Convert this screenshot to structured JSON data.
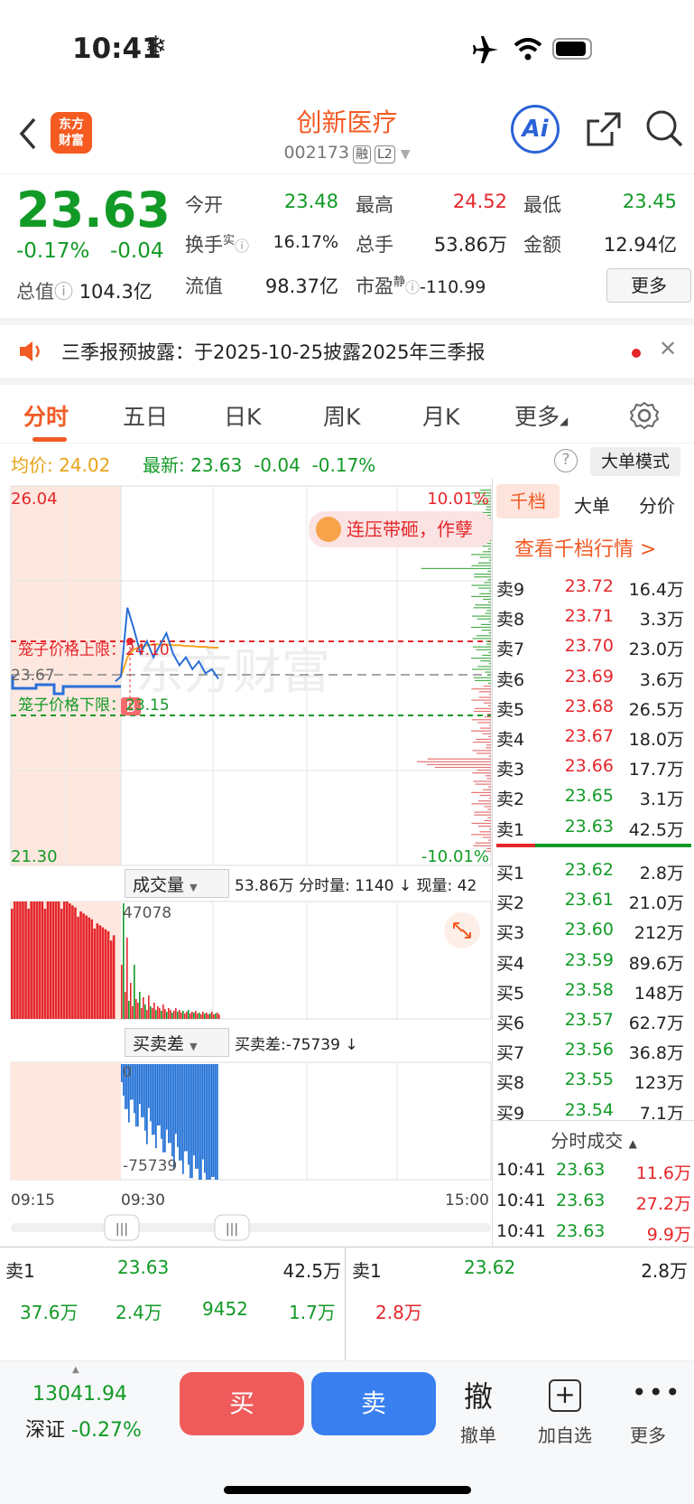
{
  "status": {
    "time": "10:41"
  },
  "header": {
    "logo": "东方\n财富",
    "title": "创新医疗",
    "code": "002173",
    "tag1": "融",
    "tag2": "L2",
    "ai_label": "Ai"
  },
  "quote": {
    "price": "23.63",
    "change_pct": "-0.17%",
    "change": "-0.04",
    "open_label": "今开",
    "open": "23.48",
    "high_label": "最高",
    "high": "24.52",
    "low_label": "最低",
    "low": "23.45",
    "turnover_label": "换手",
    "turnover_sup": "实",
    "turnover": "16.17%",
    "vol_label": "总手",
    "vol": "53.86万",
    "amount_label": "金额",
    "amount": "12.94亿",
    "mcap_label": "总值",
    "mcap": "104.3亿",
    "float_label": "流值",
    "float": "98.37亿",
    "pe_label": "市盈",
    "pe_sup": "静",
    "pe": "-110.99",
    "more": "更多"
  },
  "notice": {
    "text": "三季报预披露：于2025-10-25披露2025年三季报"
  },
  "tabs": [
    "分时",
    "五日",
    "日K",
    "周K",
    "月K",
    "更多"
  ],
  "chart": {
    "avg_label": "均价:",
    "avg": "24.02",
    "last_label": "最新:",
    "last": "23.63",
    "chg": "-0.04",
    "chg_pct": "-0.17%",
    "mode_btn": "大单模式",
    "y_top": "26.04",
    "y_bottom": "21.30",
    "pct_top": "10.01%",
    "pct_bottom": "-10.01%",
    "prev_close": "23.67",
    "cage_upper": "笼子价格上限：24.10",
    "cage_lower": "笼子价格下限：23.15",
    "buy_marker": "B",
    "bubble": "连压带砸，作孽",
    "vol_select": "成交量",
    "vol_info": "53.86万 分时量: 1140 ↓ 现量: 42",
    "vol_peak": "47078",
    "diff_select": "买卖差",
    "diff_info": "买卖差:-75739 ↓",
    "diff_min": "-75739",
    "diff_zero": "0",
    "t_start": "09:15",
    "t_open": "09:30",
    "t_end": "15:00"
  },
  "chart_data": {
    "type": "line",
    "title": "",
    "x": [
      "09:15",
      "09:30",
      "09:35",
      "09:40",
      "09:45",
      "09:50",
      "09:55",
      "10:00",
      "10:05",
      "10:10",
      "10:15",
      "10:20",
      "10:25",
      "10:30",
      "10:35",
      "10:40",
      "10:41"
    ],
    "series": [
      {
        "name": "最新",
        "values": [
          23.6,
          23.66,
          24.52,
          24.25,
          23.95,
          24.1,
          23.9,
          24.05,
          24.2,
          23.95,
          23.8,
          23.9,
          23.75,
          23.85,
          23.7,
          23.75,
          23.63
        ]
      },
      {
        "name": "均价",
        "values": [
          null,
          23.66,
          23.9,
          24.0,
          24.03,
          24.05,
          24.06,
          24.06,
          24.06,
          24.05,
          24.05,
          24.04,
          24.04,
          24.03,
          24.03,
          24.02,
          24.02
        ]
      }
    ],
    "ylim": [
      21.3,
      26.04
    ]
  },
  "orderbook": {
    "tabs": [
      "千档",
      "大单",
      "分价"
    ],
    "link": "查看千档行情 >",
    "asks": [
      {
        "l": "卖9",
        "p": "23.72",
        "v": "16.4万"
      },
      {
        "l": "卖8",
        "p": "23.71",
        "v": "3.3万"
      },
      {
        "l": "卖7",
        "p": "23.70",
        "v": "23.0万"
      },
      {
        "l": "卖6",
        "p": "23.69",
        "v": "3.6万"
      },
      {
        "l": "卖5",
        "p": "23.68",
        "v": "26.5万"
      },
      {
        "l": "卖4",
        "p": "23.67",
        "v": "18.0万"
      },
      {
        "l": "卖3",
        "p": "23.66",
        "v": "17.7万"
      },
      {
        "l": "卖2",
        "p": "23.65",
        "v": "3.1万"
      },
      {
        "l": "卖1",
        "p": "23.63",
        "v": "42.5万"
      }
    ],
    "bids": [
      {
        "l": "买1",
        "p": "23.62",
        "v": "2.8万"
      },
      {
        "l": "买2",
        "p": "23.61",
        "v": "21.0万"
      },
      {
        "l": "买3",
        "p": "23.60",
        "v": "212万"
      },
      {
        "l": "买4",
        "p": "23.59",
        "v": "89.6万"
      },
      {
        "l": "买5",
        "p": "23.58",
        "v": "148万"
      },
      {
        "l": "买6",
        "p": "23.57",
        "v": "62.7万"
      },
      {
        "l": "买7",
        "p": "23.56",
        "v": "36.8万"
      },
      {
        "l": "买8",
        "p": "23.55",
        "v": "123万"
      },
      {
        "l": "买9",
        "p": "23.54",
        "v": "7.1万"
      }
    ],
    "ticks_title": "分时成交",
    "ticks": [
      {
        "t": "10:41",
        "p": "23.63",
        "v": "11.6万"
      },
      {
        "t": "10:41",
        "p": "23.63",
        "v": "27.2万"
      },
      {
        "t": "10:41",
        "p": "23.63",
        "v": "9.9万"
      }
    ]
  },
  "bottom_book": {
    "ask1_label": "卖1",
    "ask1_p": "23.63",
    "ask1_v": "42.5万",
    "bid1_label": "卖1",
    "bid1_p": "23.62",
    "bid1_v": "2.8万",
    "row": [
      "37.6万",
      "2.4万",
      "9452",
      "1.7万"
    ],
    "right": "2.8万"
  },
  "bar": {
    "index": "13041.94",
    "index_name": "深证",
    "index_chg": "-0.27%",
    "buy": "买",
    "sell": "卖",
    "cancel_icon": "撤",
    "cancel": "撤单",
    "add": "加自选",
    "more": "更多"
  }
}
